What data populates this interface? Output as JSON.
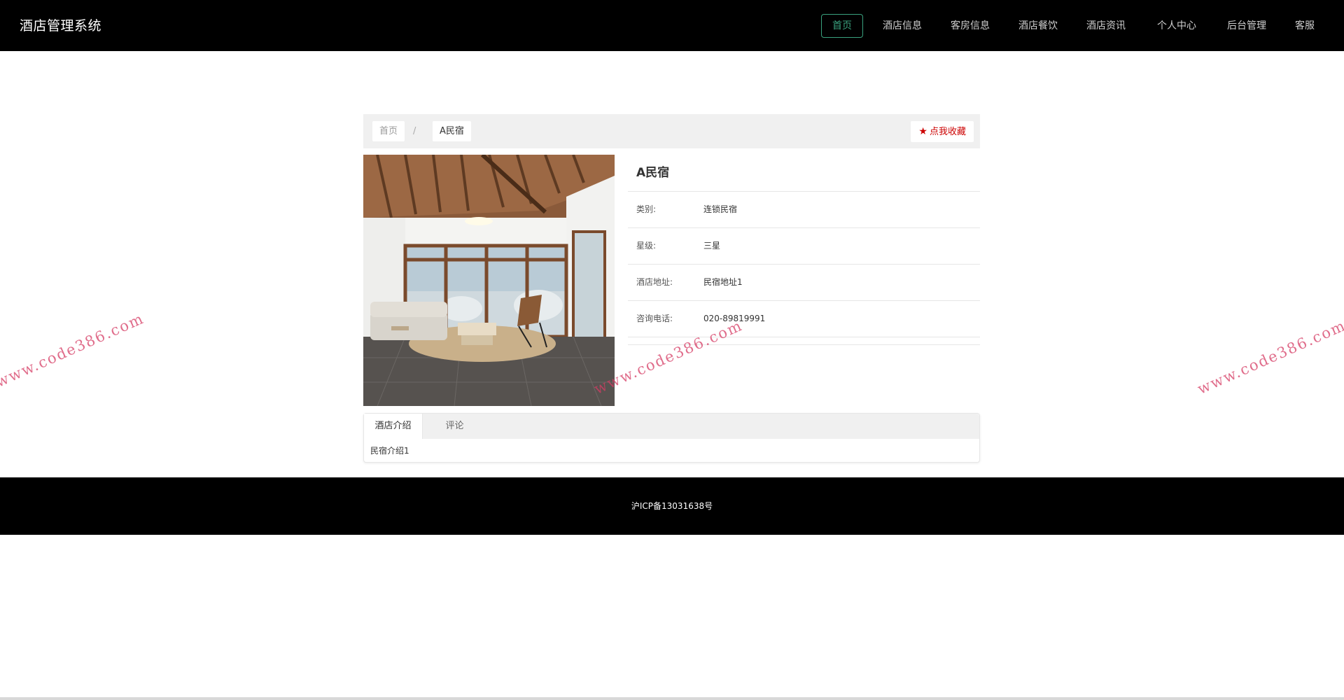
{
  "header": {
    "brand": "酒店管理系统",
    "nav": [
      {
        "label": "首页",
        "active": true
      },
      {
        "label": "酒店信息",
        "active": false
      },
      {
        "label": "客房信息",
        "active": false
      },
      {
        "label": "酒店餐饮",
        "active": false
      },
      {
        "label": "酒店资讯",
        "active": false
      },
      {
        "label": "个人中心",
        "active": false
      },
      {
        "label": "后台管理",
        "active": false
      },
      {
        "label": "客服",
        "active": false
      }
    ]
  },
  "breadcrumb": {
    "home": "首页",
    "separator": "/",
    "current": "A民宿"
  },
  "favorite": {
    "icon": "star-icon",
    "label": "点我收藏"
  },
  "hotel": {
    "name": "A民宿",
    "photo": "living-room-photo",
    "fields": [
      {
        "label": "类别:",
        "value": "连锁民宿"
      },
      {
        "label": "星级:",
        "value": "三星"
      },
      {
        "label": "酒店地址:",
        "value": "民宿地址1"
      },
      {
        "label": "咨询电话:",
        "value": "020-89819991"
      }
    ]
  },
  "tabs": {
    "items": [
      {
        "label": "酒店介绍",
        "active": true
      },
      {
        "label": "评论",
        "active": false
      }
    ],
    "content": "民宿介绍1"
  },
  "footer": {
    "icp": "沪ICP备13031638号"
  },
  "watermark": "www.code386.com",
  "colors": {
    "header_bg": "#000000",
    "accent": "#3aa17e",
    "favorite": "#cc0000"
  }
}
